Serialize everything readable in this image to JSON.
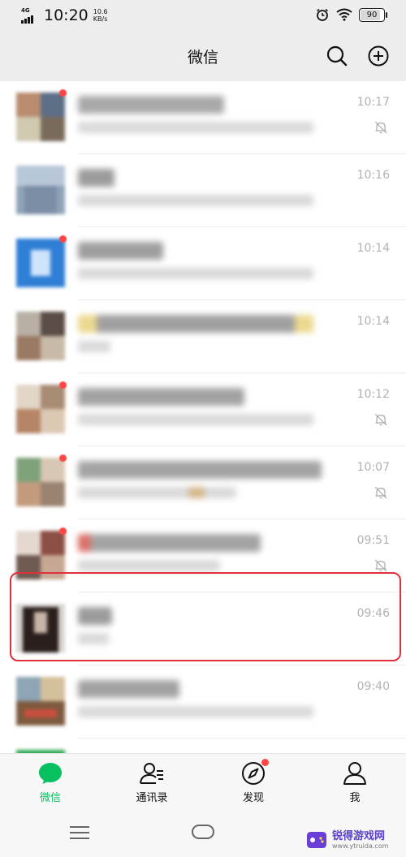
{
  "status_bar": {
    "network": "4G",
    "time": "10:20",
    "speed_value": "10.6",
    "speed_unit": "KB/s",
    "battery": "90"
  },
  "header": {
    "title": "微信"
  },
  "chats": [
    {
      "time": "10:17",
      "muted": true,
      "unread_dot": true
    },
    {
      "time": "10:16",
      "muted": false,
      "unread_dot": false
    },
    {
      "time": "10:14",
      "muted": false,
      "unread_dot": true
    },
    {
      "time": "10:14",
      "muted": false,
      "unread_dot": false
    },
    {
      "time": "10:12",
      "muted": true,
      "unread_dot": true
    },
    {
      "time": "10:07",
      "muted": true,
      "unread_dot": true
    },
    {
      "time": "09:51",
      "muted": true,
      "unread_dot": true
    },
    {
      "time": "09:46",
      "muted": false,
      "unread_dot": false,
      "highlighted": true
    },
    {
      "time": "09:40",
      "muted": false,
      "unread_dot": false
    }
  ],
  "tabs": [
    {
      "label": "微信",
      "icon": "chat-bubble-icon",
      "active": true
    },
    {
      "label": "通讯录",
      "icon": "contacts-icon",
      "active": false
    },
    {
      "label": "发现",
      "icon": "compass-icon",
      "active": false,
      "badge": true
    },
    {
      "label": "我",
      "icon": "profile-icon",
      "active": false
    }
  ],
  "watermark": {
    "text": "锐得游戏网",
    "url": "www.ytruida.com"
  },
  "colors": {
    "accent": "#07c160",
    "badge": "#ff4444",
    "highlight": "#e0303a"
  }
}
